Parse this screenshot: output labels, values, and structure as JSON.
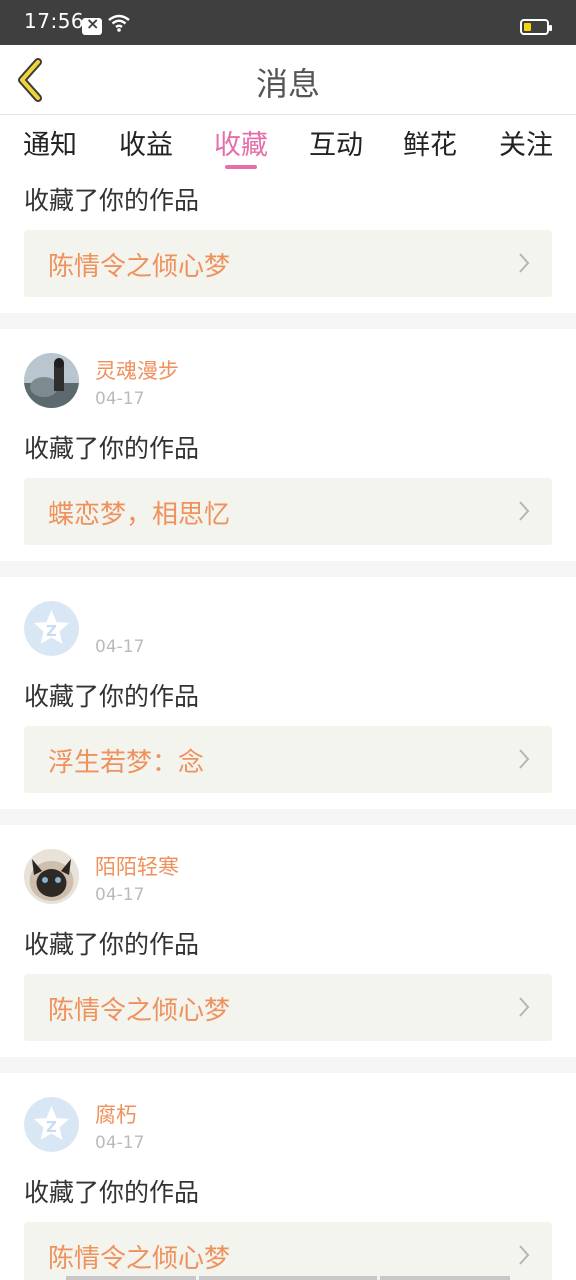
{
  "status_bar": {
    "time": "17:56"
  },
  "header": {
    "title": "消息"
  },
  "tabs": [
    {
      "label": "通知"
    },
    {
      "label": "收益"
    },
    {
      "label": "收藏"
    },
    {
      "label": "互动"
    },
    {
      "label": "鲜花"
    },
    {
      "label": "关注"
    }
  ],
  "active_tab": "收藏",
  "feed": [
    {
      "username": "",
      "date": "",
      "action": "收藏了你的作品",
      "work_title": "陈情令之倾心梦",
      "avatar": "partial-avatar"
    },
    {
      "username": "灵魂漫步",
      "date": "04-17",
      "action": "收藏了你的作品",
      "work_title": "蝶恋梦，相思忆",
      "avatar": "photo-avatar"
    },
    {
      "username": "",
      "date": "04-17",
      "action": "收藏了你的作品",
      "work_title": "浮生若梦：念",
      "avatar": "default-star-avatar"
    },
    {
      "username": "陌陌轻寒",
      "date": "04-17",
      "action": "收藏了你的作品",
      "work_title": "陈情令之倾心梦",
      "avatar": "cat-avatar"
    },
    {
      "username": "腐朽",
      "date": "04-17",
      "action": "收藏了你的作品",
      "work_title": "陈情令之倾心梦",
      "avatar": "default-star-avatar"
    }
  ]
}
